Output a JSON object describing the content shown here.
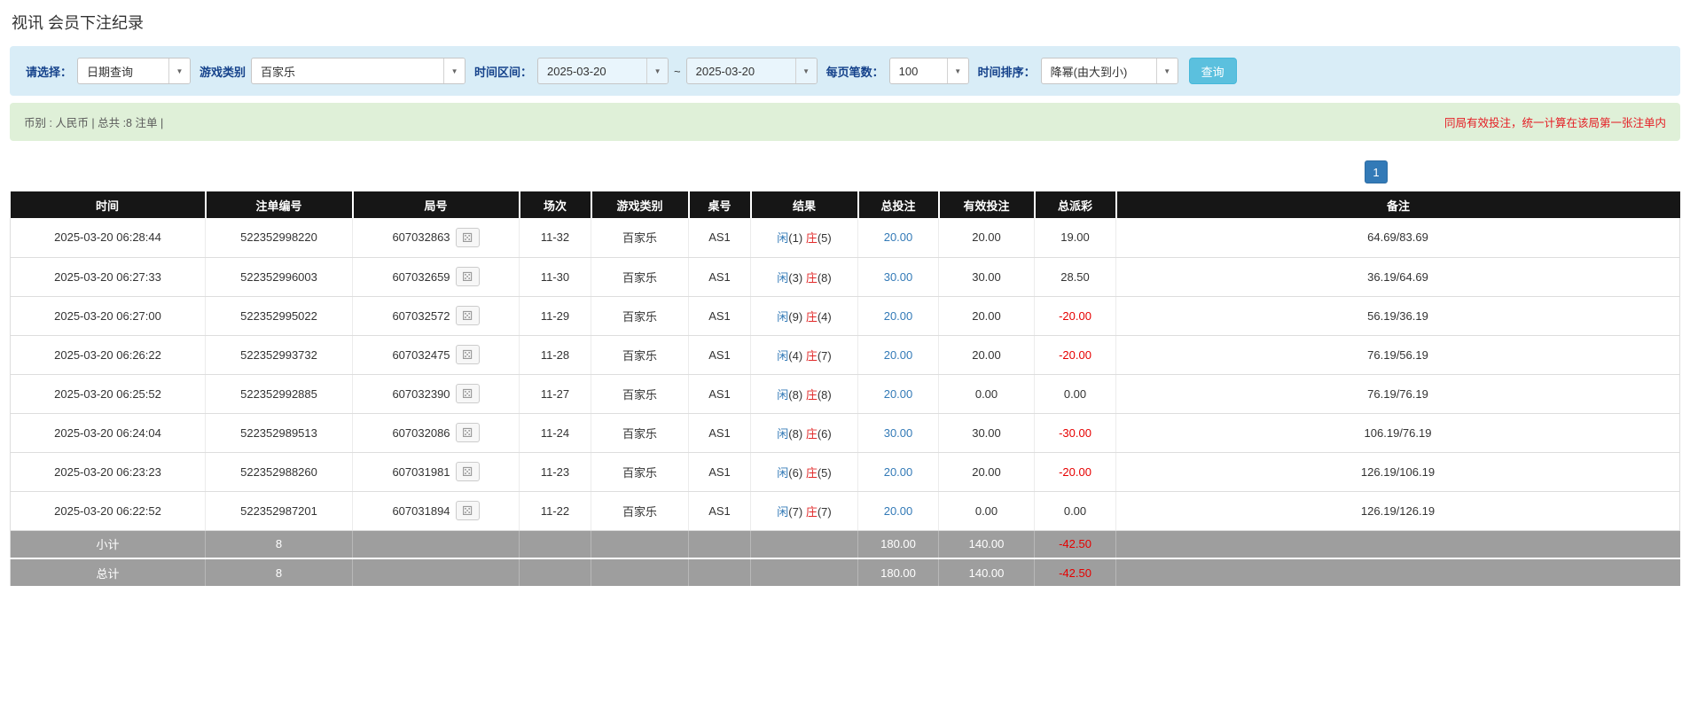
{
  "page": {
    "title": "视讯 会员下注纪录"
  },
  "filters": {
    "select_label": "请选择：",
    "select_value": "日期查询",
    "game_type_label": "游戏类别",
    "game_type_value": "百家乐",
    "date_range_label": "时间区间：",
    "date_from": "2025-03-20",
    "tilde": "~",
    "date_to": "2025-03-20",
    "page_size_label": "每页笔数：",
    "page_size_value": "100",
    "sort_label": "时间排序：",
    "sort_value": "降幂(由大到小)",
    "search_button": "查询",
    "caret": "▼"
  },
  "summary_bar": {
    "left": "币别 : 人民币 | 总共 :8 注单 |",
    "right": "同局有效投注，统一计算在该局第一张注单内"
  },
  "pagination": {
    "current_page": "1"
  },
  "table": {
    "headers": [
      "时间",
      "注单编号",
      "局号",
      "场次",
      "游戏类别",
      "桌号",
      "结果",
      "总投注",
      "有效投注",
      "总派彩",
      "备注"
    ],
    "dice_icon": "⚄",
    "rows": [
      {
        "time": "2025-03-20 06:28:44",
        "bet_id": "522352998220",
        "round_id": "607032863",
        "session": "11-32",
        "game": "百家乐",
        "table_no": "AS1",
        "result_player": "闲(1)",
        "result_banker": "庄(5)",
        "total_bet": "20.00",
        "valid_bet": "20.00",
        "payout": "19.00",
        "note": "64.69/83.69"
      },
      {
        "time": "2025-03-20 06:27:33",
        "bet_id": "522352996003",
        "round_id": "607032659",
        "session": "11-30",
        "game": "百家乐",
        "table_no": "AS1",
        "result_player": "闲(3)",
        "result_banker": "庄(8)",
        "total_bet": "30.00",
        "valid_bet": "30.00",
        "payout": "28.50",
        "note": "36.19/64.69"
      },
      {
        "time": "2025-03-20 06:27:00",
        "bet_id": "522352995022",
        "round_id": "607032572",
        "session": "11-29",
        "game": "百家乐",
        "table_no": "AS1",
        "result_player": "闲(9)",
        "result_banker": "庄(4)",
        "total_bet": "20.00",
        "valid_bet": "20.00",
        "payout": "-20.00",
        "note": "56.19/36.19"
      },
      {
        "time": "2025-03-20 06:26:22",
        "bet_id": "522352993732",
        "round_id": "607032475",
        "session": "11-28",
        "game": "百家乐",
        "table_no": "AS1",
        "result_player": "闲(4)",
        "result_banker": "庄(7)",
        "total_bet": "20.00",
        "valid_bet": "20.00",
        "payout": "-20.00",
        "note": "76.19/56.19"
      },
      {
        "time": "2025-03-20 06:25:52",
        "bet_id": "522352992885",
        "round_id": "607032390",
        "session": "11-27",
        "game": "百家乐",
        "table_no": "AS1",
        "result_player": "闲(8)",
        "result_banker": "庄(8)",
        "total_bet": "20.00",
        "valid_bet": "0.00",
        "payout": "0.00",
        "note": "76.19/76.19"
      },
      {
        "time": "2025-03-20 06:24:04",
        "bet_id": "522352989513",
        "round_id": "607032086",
        "session": "11-24",
        "game": "百家乐",
        "table_no": "AS1",
        "result_player": "闲(8)",
        "result_banker": "庄(6)",
        "total_bet": "30.00",
        "valid_bet": "30.00",
        "payout": "-30.00",
        "note": "106.19/76.19"
      },
      {
        "time": "2025-03-20 06:23:23",
        "bet_id": "522352988260",
        "round_id": "607031981",
        "session": "11-23",
        "game": "百家乐",
        "table_no": "AS1",
        "result_player": "闲(6)",
        "result_banker": "庄(5)",
        "total_bet": "20.00",
        "valid_bet": "20.00",
        "payout": "-20.00",
        "note": "126.19/106.19"
      },
      {
        "time": "2025-03-20 06:22:52",
        "bet_id": "522352987201",
        "round_id": "607031894",
        "session": "11-22",
        "game": "百家乐",
        "table_no": "AS1",
        "result_player": "闲(7)",
        "result_banker": "庄(7)",
        "total_bet": "20.00",
        "valid_bet": "0.00",
        "payout": "0.00",
        "note": "126.19/126.19"
      }
    ],
    "subtotal": {
      "label": "小计",
      "count": "8",
      "total_bet": "180.00",
      "valid_bet": "140.00",
      "payout": "-42.50"
    },
    "total": {
      "label": "总计",
      "count": "8",
      "total_bet": "180.00",
      "valid_bet": "140.00",
      "payout": "-42.50"
    }
  }
}
